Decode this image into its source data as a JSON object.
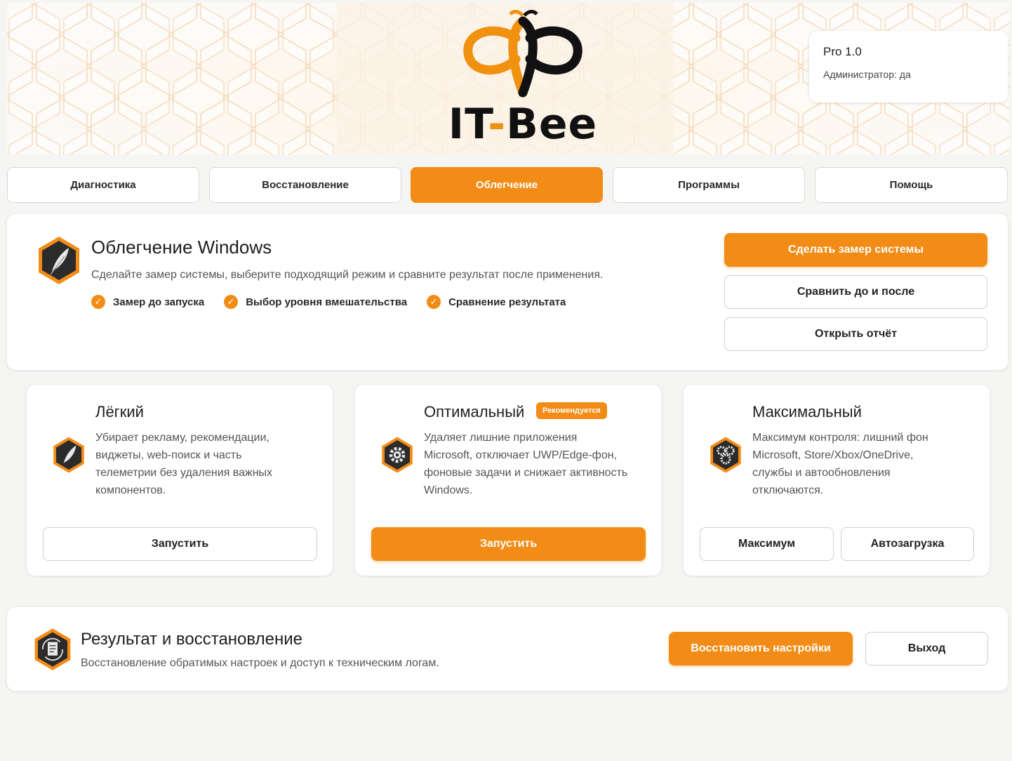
{
  "colors": {
    "accent": "#f28c16",
    "background": "#f5f5f4",
    "card": "#ffffff"
  },
  "header": {
    "logo_text_1": "IT",
    "logo_dash": "-",
    "logo_text_2": "Bee",
    "version": "Pro 1.0",
    "admin": "Администратор: да"
  },
  "tabs": [
    {
      "label": "Диагностика",
      "active": false
    },
    {
      "label": "Восстановление",
      "active": false
    },
    {
      "label": "Облегчение",
      "active": true
    },
    {
      "label": "Программы",
      "active": false
    },
    {
      "label": "Помощь",
      "active": false
    }
  ],
  "intro": {
    "icon": "feather-icon",
    "title": "Облегчение Windows",
    "subtitle": "Сделайте замер системы, выберите подходящий режим и сравните результат после применения.",
    "checks": [
      "Замер до запуска",
      "Выбор уровня вмешательства",
      "Сравнение результата"
    ],
    "buttons": {
      "measure": "Сделать замер системы",
      "compare": "Сравнить до и после",
      "report": "Открыть отчёт"
    }
  },
  "modes": [
    {
      "icon": "feather-icon",
      "title": "Лёгкий",
      "desc": [
        "Убирает рекламу, рекомендации,",
        "виджеты, web-поиск и часть",
        "телеметрии без удаления важных",
        "компонентов."
      ],
      "button": "Запустить"
    },
    {
      "icon": "gear-icon",
      "title": "Оптимальный",
      "badge": "Рекомендуется",
      "desc": [
        "Удаляет лишние приложения",
        "Microsoft, отключает UWP/Edge-фон,",
        "фоновые задачи и снижает активность",
        "Windows."
      ],
      "button": "Запустить"
    },
    {
      "icon": "gears-icon",
      "title": "Максимальный",
      "desc": [
        "Максимум контроля: лишний фон",
        "Microsoft, Store/Xbox/OneDrive,",
        "службы и автообновления",
        "отключаются."
      ],
      "button_1": "Максимум",
      "button_2": "Автозагрузка"
    }
  ],
  "result": {
    "icon": "restore-icon",
    "title": "Результат и восстановление",
    "subtitle": "Восстановление обратимых настроек и доступ к техническим логам.",
    "restore_button": "Восстановить настройки",
    "exit_button": "Выход"
  }
}
